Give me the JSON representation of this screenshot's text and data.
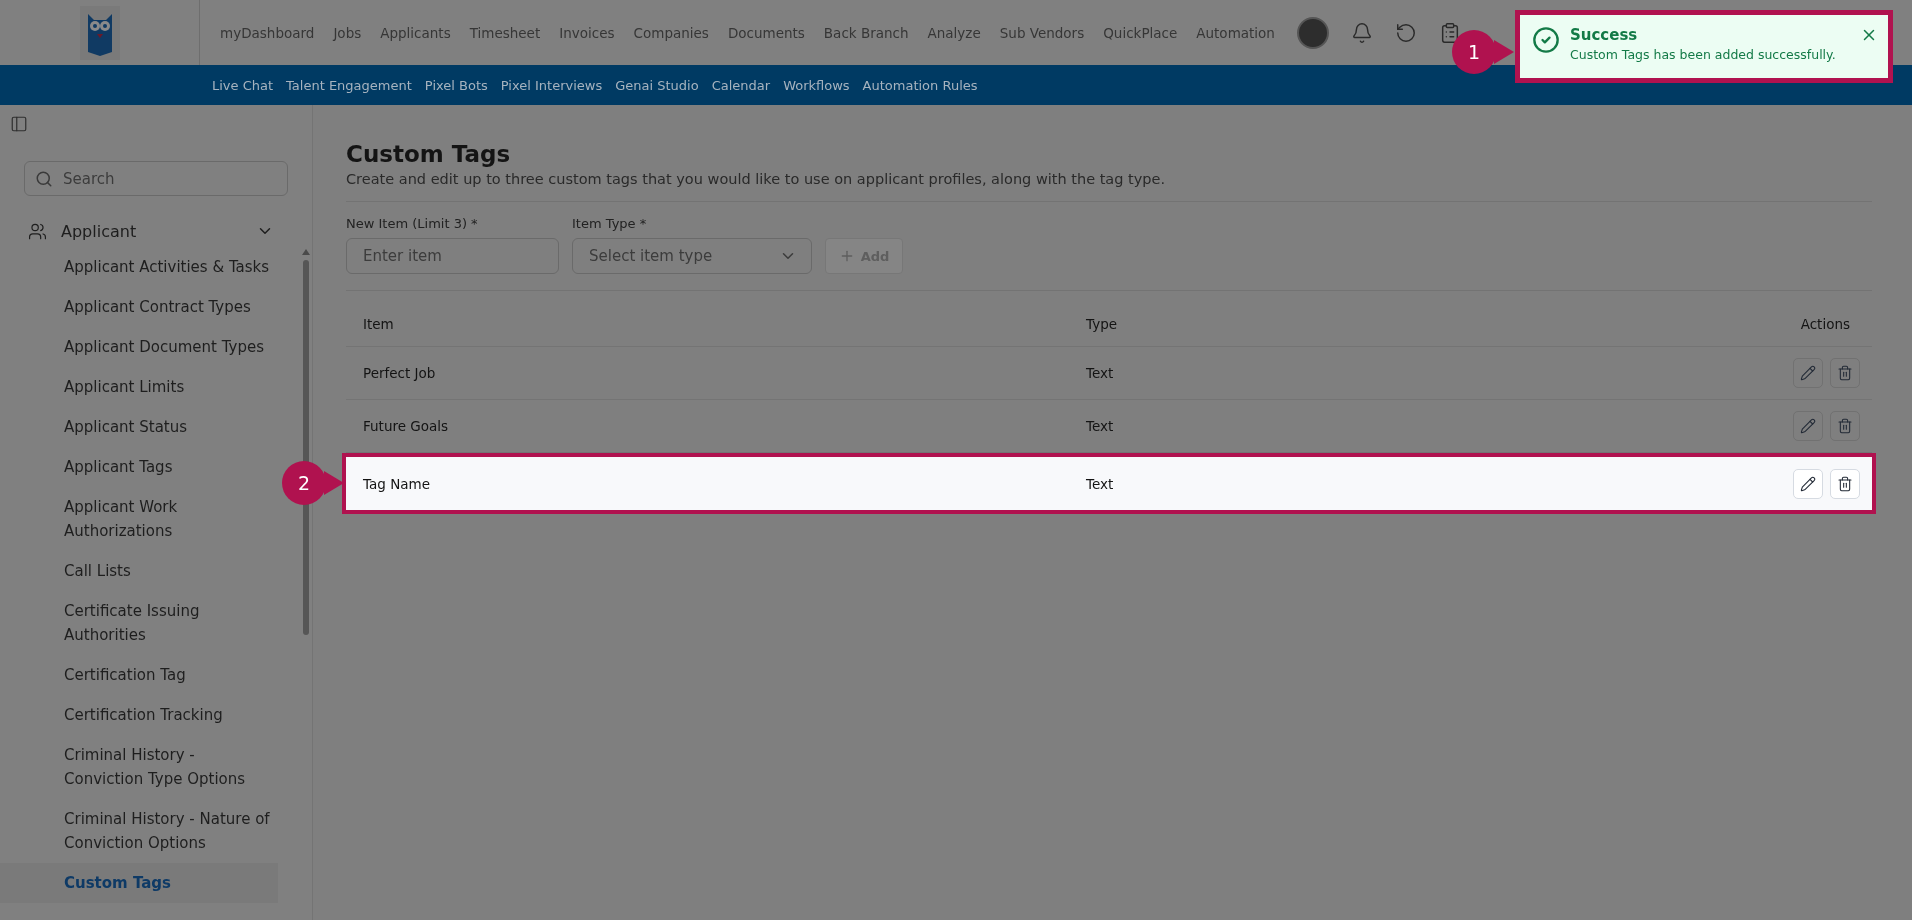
{
  "top_nav": {
    "items": [
      "myDashboard",
      "Jobs",
      "Applicants",
      "Timesheet",
      "Invoices",
      "Companies",
      "Documents",
      "Back Branch",
      "Analyze",
      "Sub Vendors",
      "QuickPlace",
      "Automation"
    ]
  },
  "sub_nav": {
    "items": [
      "Live Chat",
      "Talent Engagement",
      "Pixel Bots",
      "Pixel Interviews",
      "Genai Studio",
      "Calendar",
      "Workflows",
      "Automation Rules"
    ]
  },
  "toast": {
    "title": "Success",
    "message": "Custom Tags has been added successfully.",
    "callout": "1"
  },
  "sidebar": {
    "search": {
      "placeholder": "Search"
    },
    "groups": [
      {
        "label": "Applicant",
        "expanded": true,
        "children": [
          {
            "label": "Applicant Activities & Tasks",
            "selected": false
          },
          {
            "label": "Applicant Contract Types",
            "selected": false
          },
          {
            "label": "Applicant Document Types",
            "selected": false
          },
          {
            "label": "Applicant Limits",
            "selected": false
          },
          {
            "label": "Applicant Status",
            "selected": false
          },
          {
            "label": "Applicant Tags",
            "selected": false
          },
          {
            "label": "Applicant Work\nAuthorizations",
            "selected": false
          },
          {
            "label": "Call Lists",
            "selected": false
          },
          {
            "label": "Certificate Issuing\nAuthorities",
            "selected": false
          },
          {
            "label": "Certification Tag",
            "selected": false
          },
          {
            "label": "Certification Tracking",
            "selected": false
          },
          {
            "label": "Criminal History -\nConviction Type Options",
            "selected": false
          },
          {
            "label": "Criminal History - Nature of\nConviction Options",
            "selected": false
          },
          {
            "label": "Custom Tags",
            "selected": true
          }
        ]
      }
    ]
  },
  "page": {
    "title": "Custom Tags",
    "description": "Create and edit up to three custom tags that you would like to use on applicant profiles, along with the tag type."
  },
  "form": {
    "fields": [
      {
        "kind": "input",
        "label": "New Item (Limit 3) *",
        "placeholder": "Enter item"
      },
      {
        "kind": "select",
        "label": "Item Type *",
        "placeholder": "Select item type"
      }
    ],
    "add_button": {
      "label": "Add",
      "disabled": true
    }
  },
  "table": {
    "columns": [
      "Item",
      "Type",
      "Actions"
    ],
    "rows": [
      {
        "cells": [
          "Perfect Job",
          "Text"
        ],
        "highlighted": false
      },
      {
        "cells": [
          "Future Goals",
          "Text"
        ],
        "highlighted": false
      },
      {
        "cells": [
          "Tag Name",
          "Text"
        ],
        "highlighted": true,
        "callout": "2"
      }
    ]
  }
}
